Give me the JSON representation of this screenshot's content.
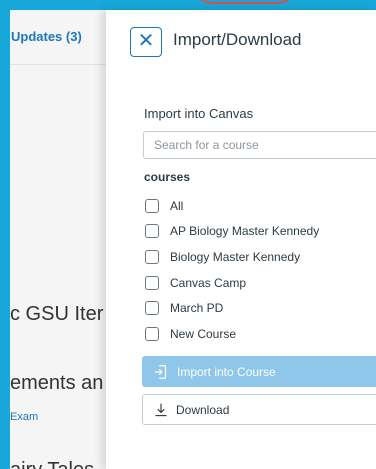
{
  "background": {
    "updates_link": "Updates (3)",
    "headings": [
      "c GSU Iter",
      "ements an",
      "airy Tales"
    ],
    "link": "Exam"
  },
  "tray": {
    "title": "Import/Download",
    "close_icon": "close-icon",
    "import_label": "Import into Canvas",
    "search_placeholder": "Search for a course",
    "courses_heading": "courses",
    "courses": [
      {
        "label": "All",
        "checked": false
      },
      {
        "label": "AP Biology Master Kennedy",
        "checked": false
      },
      {
        "label": "Biology Master Kennedy",
        "checked": false
      },
      {
        "label": "Canvas Camp",
        "checked": false
      },
      {
        "label": "March PD",
        "checked": false
      },
      {
        "label": "New Course",
        "checked": false
      }
    ],
    "import_button": {
      "label": "Import into Course",
      "icon": "import-icon",
      "disabled": true
    },
    "download_button": {
      "label": "Download",
      "icon": "download-icon"
    }
  },
  "colors": {
    "frame": "#17a7d8",
    "accent": "#1b78bb",
    "import_button_bg": "#8ec7ea"
  }
}
